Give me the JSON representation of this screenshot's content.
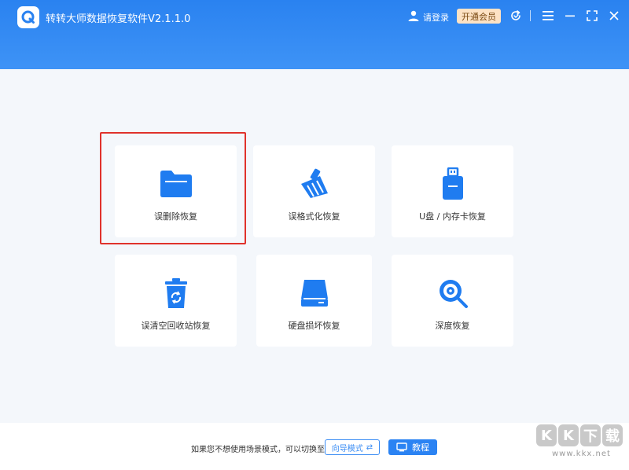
{
  "header": {
    "app_title": "转转大师数据恢复软件V2.1.1.0",
    "login_label": "请登录",
    "vip_label": "开通会员",
    "icons": [
      "user-icon",
      "refresh-icon",
      "menu-icon",
      "minimize-icon",
      "maximize-icon",
      "close-icon"
    ]
  },
  "cards": [
    {
      "label": "误删除恢复",
      "icon": "folder-icon"
    },
    {
      "label": "误格式化恢复",
      "icon": "broom-icon"
    },
    {
      "label": "U盘 / 内存卡恢复",
      "icon": "usb-drive-icon"
    },
    {
      "label": "误清空回收站恢复",
      "icon": "recycle-bin-icon"
    },
    {
      "label": "硬盘损坏恢复",
      "icon": "hard-drive-icon"
    },
    {
      "label": "深度恢复",
      "icon": "deep-scan-icon"
    }
  ],
  "footer": {
    "hint_text": "如果您不想使用场景模式，可以切换至",
    "guide_mode_label": "向导模式",
    "tutorial_label": "教程"
  },
  "watermark": {
    "letters": [
      "K",
      "K",
      "下",
      "载"
    ],
    "url": "www.kkx.net"
  },
  "colors": {
    "header_blue": "#2a82f0",
    "accent_blue": "#2b83f3",
    "highlight_red": "#e0322b",
    "vip_bg": "#fde2c4"
  }
}
